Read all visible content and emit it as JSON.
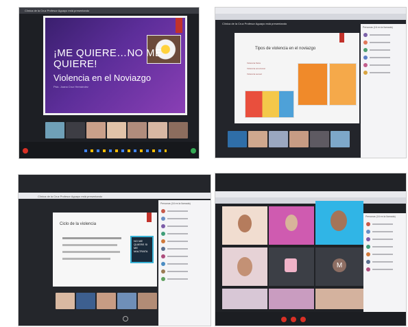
{
  "photo1": {
    "window_title": "Clínica de la Cruz Profesor Aguayo está presentando",
    "slide_title": "¡ME QUIERE…NO ME QUIERE!",
    "slide_subtitle": "Violencia en el Noviazgo",
    "slide_author": "Psic. Joana Cruz Hernández"
  },
  "photo2": {
    "window_title": "Clínica de la Cruz Profesor Aguayo está presentando",
    "slide_title": "Tipos de violencia en el noviazgo",
    "bullets": [
      "Violencia física",
      "Violencia emocional",
      "Violencia sexual"
    ],
    "sidebar_header": "Personas (16 en la llamada)"
  },
  "photo3": {
    "window_title": "Clínica de la Cruz Profesor Aguayo está presentando",
    "slide_title": "Ciclo de la violencia",
    "poster_text": "NO ME QUIERE SI ME MALTRATA",
    "sidebar_header": "Personas (16 en la llamada)"
  },
  "photo4": {
    "sidebar_header": "Personas (16 en la llamada)",
    "avatar_letter": "M"
  },
  "colors": {
    "slide_purple": "#5d2e9a",
    "meet_red": "#c2322b",
    "poster_blue": "#39b3d6"
  }
}
